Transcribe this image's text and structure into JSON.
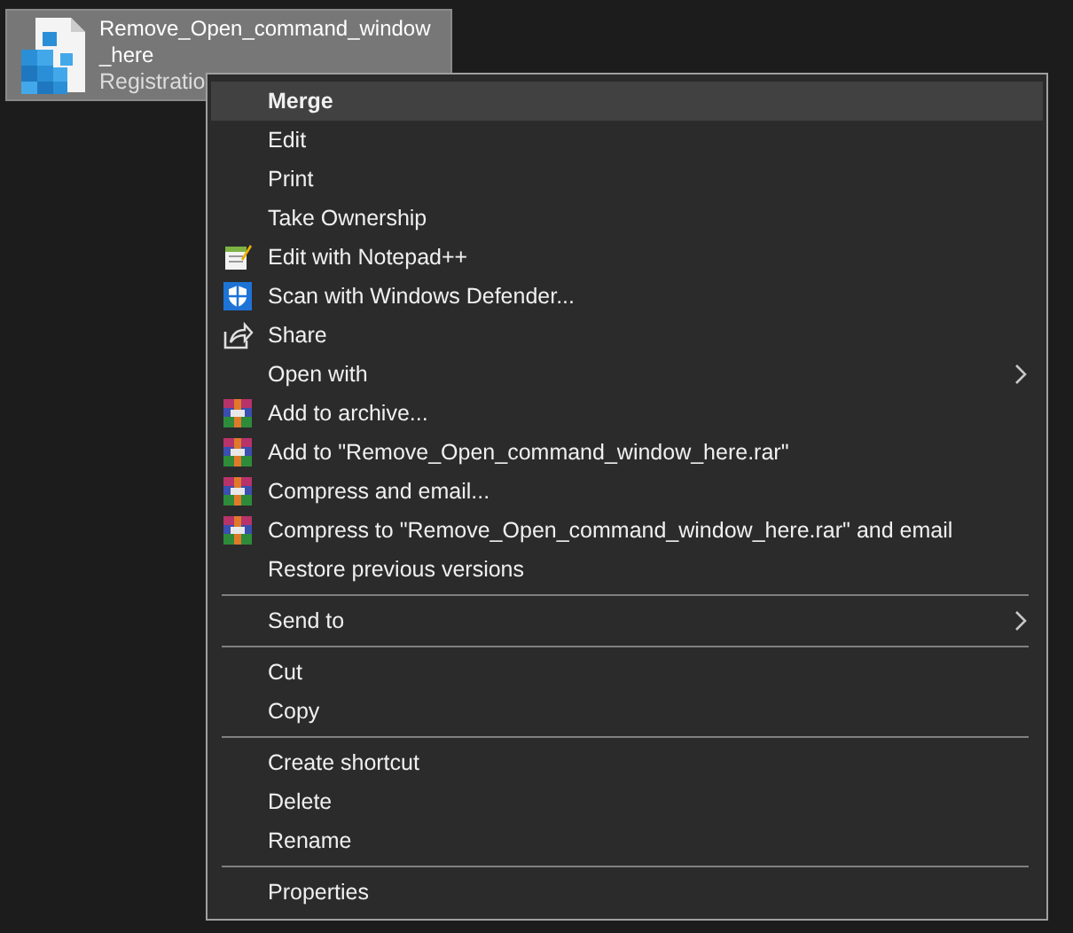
{
  "file": {
    "name_lines": [
      "Remove_Open_command_window",
      "_here"
    ],
    "type_label": "Registratio",
    "selected": true
  },
  "context_menu": {
    "items": [
      {
        "kind": "plain",
        "label": "Merge",
        "bold": true,
        "selected": true
      },
      {
        "kind": "plain",
        "label": "Edit",
        "selected": false
      },
      {
        "kind": "plain",
        "label": "Print",
        "selected": false
      },
      {
        "kind": "plain",
        "label": "Take Ownership",
        "selected": false
      },
      {
        "kind": "notepad",
        "label": "Edit with Notepad++",
        "selected": false
      },
      {
        "kind": "shield",
        "label": "Scan with Windows Defender...",
        "selected": false
      },
      {
        "kind": "share",
        "label": "Share",
        "selected": false
      },
      {
        "kind": "submenu",
        "label": "Open with",
        "selected": false
      },
      {
        "kind": "archive",
        "label": "Add to archive...",
        "selected": false
      },
      {
        "kind": "archive",
        "label": "Add to \"Remove_Open_command_window_here.rar\"",
        "selected": false
      },
      {
        "kind": "archive",
        "label": "Compress and email...",
        "selected": false
      },
      {
        "kind": "archive",
        "label": "Compress to \"Remove_Open_command_window_here.rar\" and email",
        "selected": false
      },
      {
        "kind": "plain",
        "label": "Restore previous versions",
        "selected": false
      },
      {
        "kind": "separator"
      },
      {
        "kind": "submenu",
        "label": "Send to",
        "selected": false
      },
      {
        "kind": "separator"
      },
      {
        "kind": "plain",
        "label": "Cut",
        "selected": false
      },
      {
        "kind": "plain",
        "label": "Copy",
        "selected": false
      },
      {
        "kind": "separator"
      },
      {
        "kind": "plain",
        "label": "Create shortcut",
        "selected": false
      },
      {
        "kind": "plain",
        "label": "Delete",
        "selected": false
      },
      {
        "kind": "plain",
        "label": "Rename",
        "selected": false
      },
      {
        "kind": "separator"
      },
      {
        "kind": "plain",
        "label": "Properties",
        "selected": false
      }
    ]
  }
}
